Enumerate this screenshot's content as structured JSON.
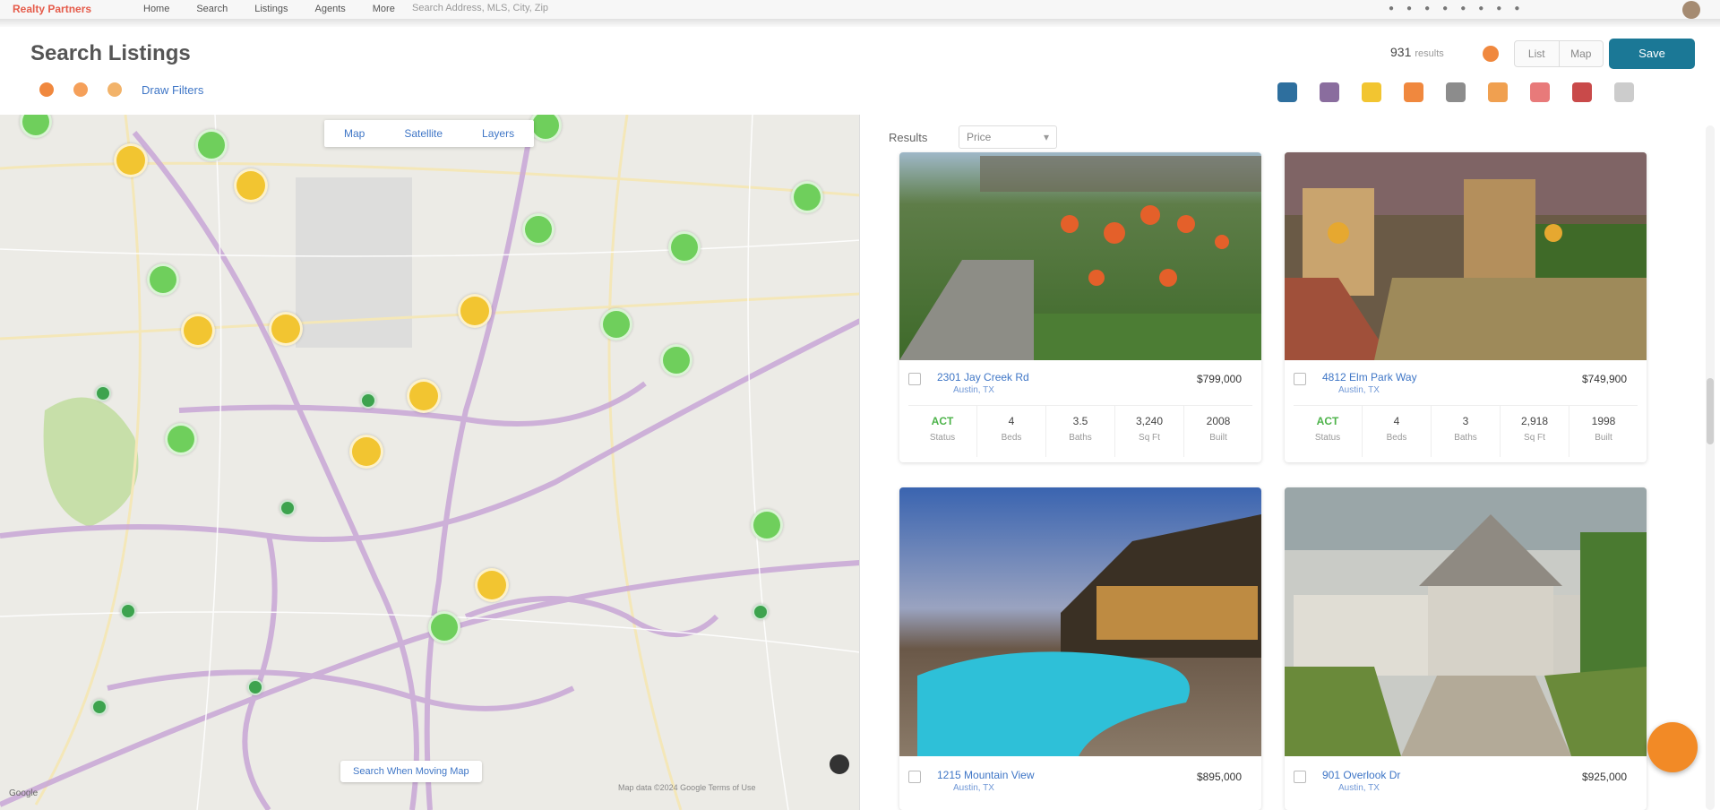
{
  "topbar": {
    "brand": "Realty Partners",
    "nav": [
      "Home",
      "Search",
      "Listings",
      "Agents",
      "More"
    ],
    "search_placeholder": "Search   Address, MLS, City, Zip",
    "icon_names": [
      "bell-icon",
      "mail-icon",
      "calendar-icon",
      "help-icon",
      "settings-icon",
      "user-icon",
      "grid-icon",
      "menu-icon"
    ]
  },
  "header": {
    "title": "Search Listings",
    "save_count": "931",
    "save_count_label": "results",
    "view_options": [
      "List",
      "Map"
    ],
    "save_button": "Save"
  },
  "filters": {
    "status_colors": [
      "#f0883e",
      "#f5a05a",
      "#f2b36a"
    ],
    "draw_link": "Draw Filters"
  },
  "toolbar": {
    "tools": [
      {
        "name": "globe-icon",
        "color": "#2e6f9e"
      },
      {
        "name": "binoculars-icon",
        "color": "#8a6d9e"
      },
      {
        "name": "star-icon",
        "color": "#f2c531"
      },
      {
        "name": "flag-icon",
        "color": "#f0883e"
      },
      {
        "name": "edit-icon",
        "color": "#8c8c8c"
      },
      {
        "name": "share-icon",
        "color": "#f0a050"
      },
      {
        "name": "chart-icon",
        "color": "#e87a7a"
      },
      {
        "name": "video-icon",
        "color": "#c94a4a"
      },
      {
        "name": "more-icon",
        "color": "#cccccc"
      }
    ]
  },
  "map": {
    "tabs": [
      "Map",
      "Satellite",
      "Layers"
    ],
    "search_toggle": "Search When Moving Map",
    "attribution": "Map data ©2024 Google  Terms of Use",
    "logo": "Google"
  },
  "results": {
    "label": "Results",
    "sort_value": "Price",
    "sort_caret": "▾"
  },
  "listings": [
    {
      "address": "2301 Jay Creek Rd",
      "city": "Austin, TX",
      "price": "$799,000",
      "stats": [
        {
          "value": "ACT",
          "label": "Status"
        },
        {
          "value": "4",
          "label": "Beds"
        },
        {
          "value": "3.5",
          "label": "Baths"
        },
        {
          "value": "3,240",
          "label": "Sq Ft"
        },
        {
          "value": "2008",
          "label": "Built"
        }
      ],
      "photo_theme": "garden"
    },
    {
      "address": "4812 Elm Park Way",
      "city": "Austin, TX",
      "price": "$749,900",
      "stats": [
        {
          "value": "ACT",
          "label": "Status"
        },
        {
          "value": "4",
          "label": "Beds"
        },
        {
          "value": "3",
          "label": "Baths"
        },
        {
          "value": "2,918",
          "label": "Sq Ft"
        },
        {
          "value": "1998",
          "label": "Built"
        }
      ],
      "photo_theme": "cottage"
    },
    {
      "address": "1215 Mountain View",
      "city": "Austin, TX",
      "price": "$895,000",
      "photo_theme": "pool"
    },
    {
      "address": "901 Overlook Dr",
      "city": "Austin, TX",
      "price": "$925,000",
      "photo_theme": "manor"
    }
  ]
}
